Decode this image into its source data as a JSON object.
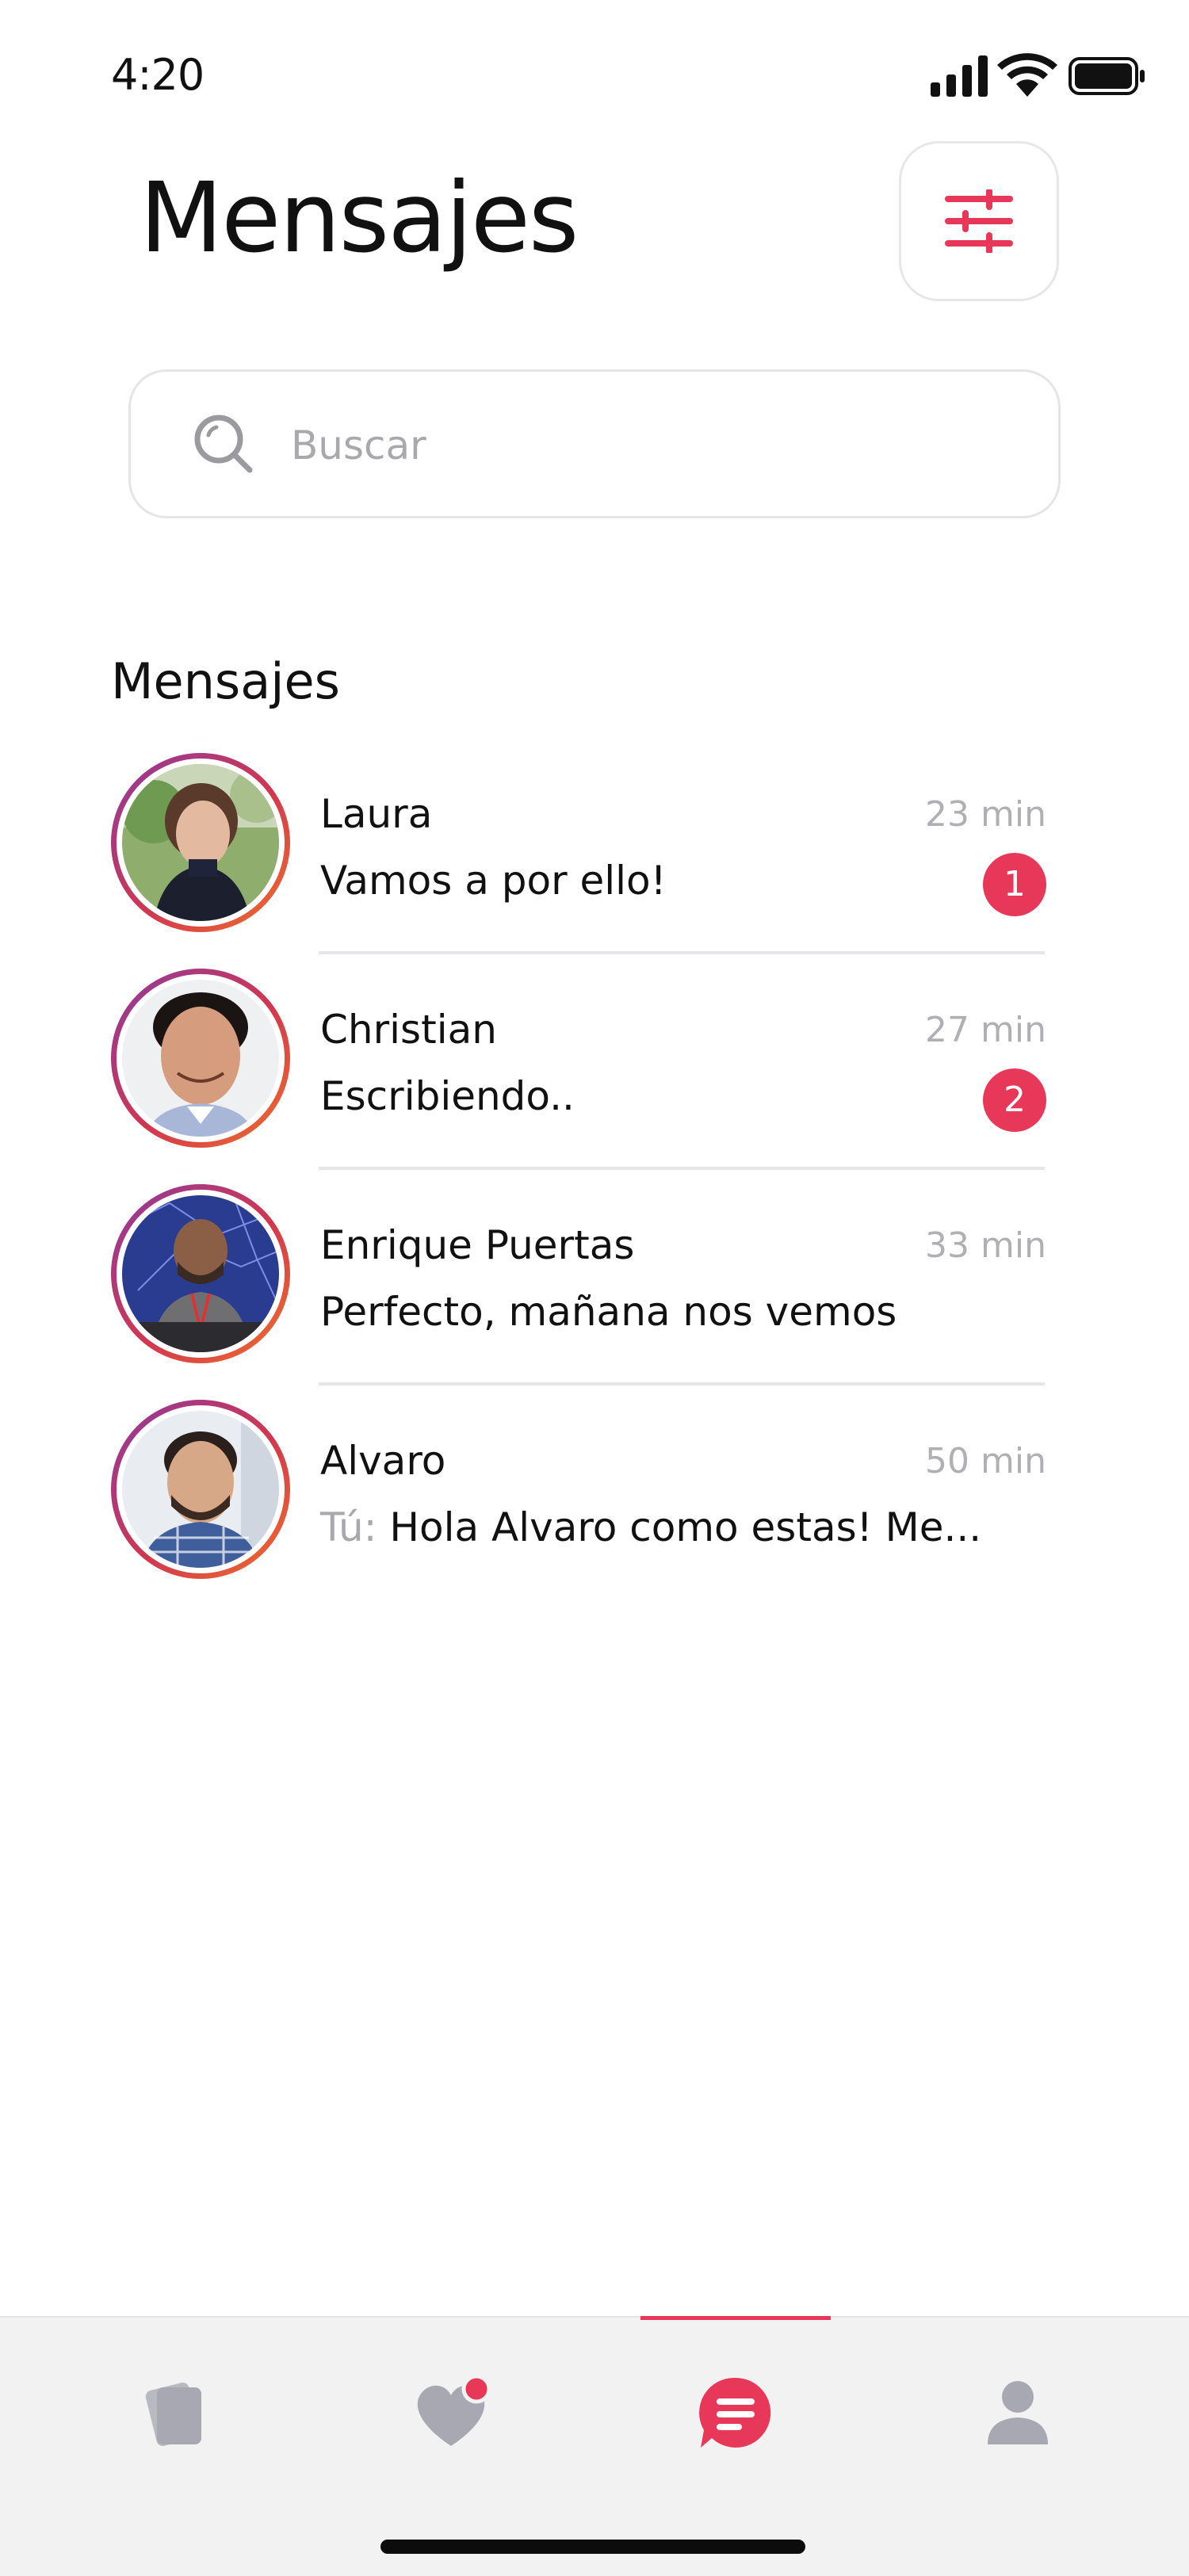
{
  "status_bar": {
    "time": "4:20"
  },
  "header": {
    "title": "Mensajes",
    "filter_icon": "sliders-icon"
  },
  "search": {
    "placeholder": "Buscar",
    "value": ""
  },
  "section": {
    "title": "Mensajes"
  },
  "messages": [
    {
      "name": "Laura",
      "time": "23 min",
      "prefix": "",
      "preview": "Vamos a por ello!",
      "unread": "1"
    },
    {
      "name": "Christian",
      "time": "27 min",
      "prefix": "",
      "preview": "Escribiendo..",
      "unread": "2"
    },
    {
      "name": "Enrique Puertas",
      "time": "33 min",
      "prefix": "",
      "preview": "Perfecto, mañana nos vemos",
      "unread": null
    },
    {
      "name": "Alvaro",
      "time": "50 min",
      "prefix": "Tú:",
      "preview": "Hola Alvaro como estas! Me...",
      "unread": null
    }
  ],
  "tabs": [
    {
      "icon": "cards-icon",
      "active": false
    },
    {
      "icon": "heart-notification-icon",
      "active": false
    },
    {
      "icon": "messages-icon",
      "active": true
    },
    {
      "icon": "profile-icon",
      "active": false
    }
  ],
  "colors": {
    "accent": "#e8385a",
    "inactive_icon": "#a8a8b2",
    "muted_text": "#b0b0b4"
  }
}
